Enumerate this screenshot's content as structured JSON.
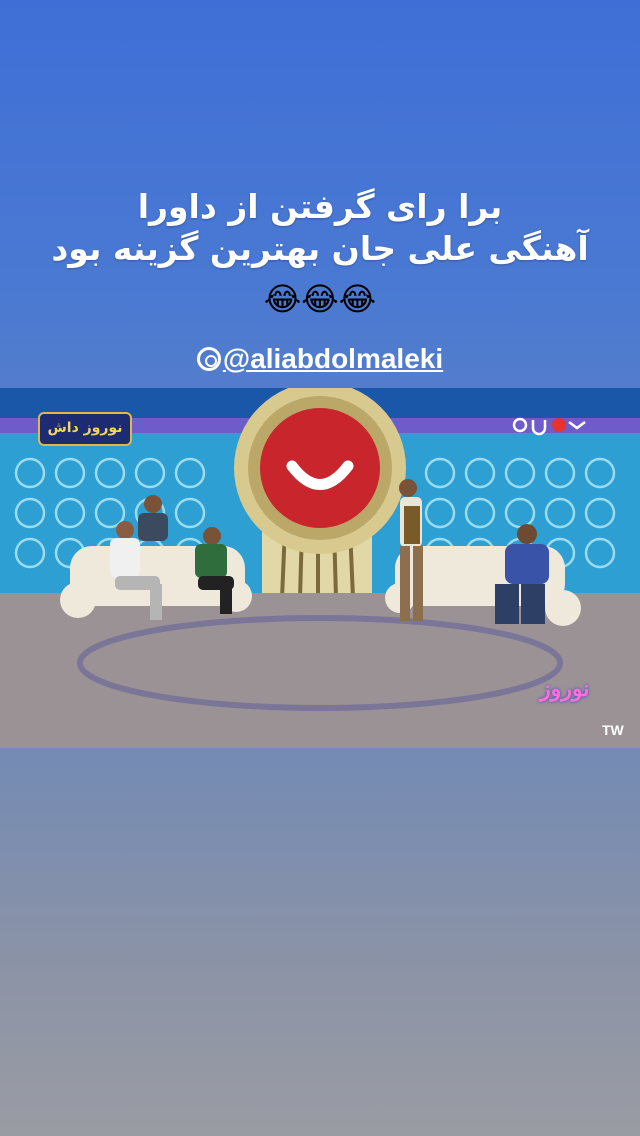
{
  "story": {
    "caption_line1": "برا رای گرفتن از داورا",
    "caption_line2": "آهنگی علی جان بهترین گزینه بود",
    "emojis": "😂😂😂",
    "mention": "@aliabdolmaleki",
    "mention_icon": "threads-icon"
  },
  "video": {
    "channel_logo": "نوروز داش",
    "corner_logo": "نوروز",
    "watermark": "TW"
  },
  "colors": {
    "bg_top": "#3f6fd6",
    "bg_bottom": "#9a9ca3",
    "studio_wall": "#37a7d8",
    "stage_center": "#c8262c"
  }
}
